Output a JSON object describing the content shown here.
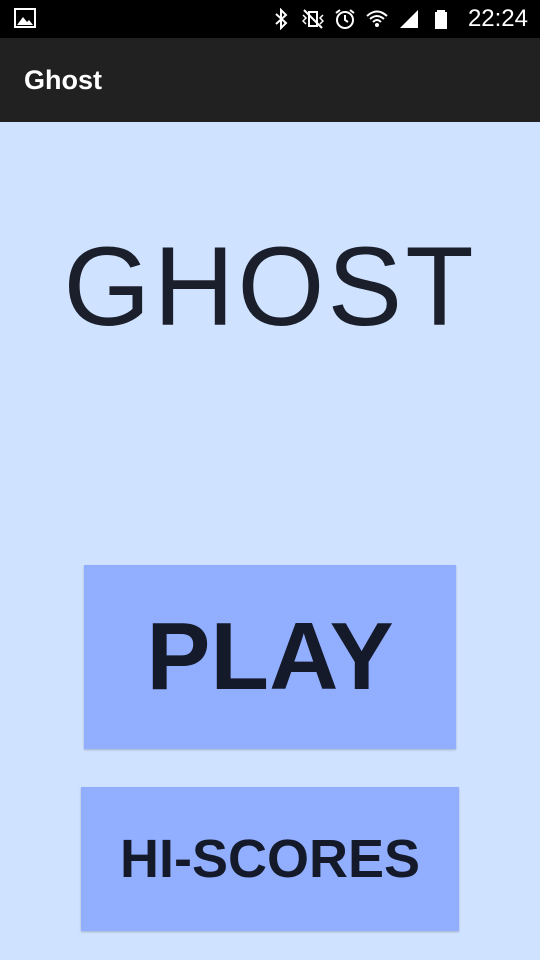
{
  "status_bar": {
    "time": "22:24",
    "icons": [
      "gallery-icon",
      "bluetooth-icon",
      "vibrate-icon",
      "alarm-icon",
      "wifi-icon",
      "cell-signal-icon",
      "battery-icon"
    ]
  },
  "app_bar": {
    "title": "Ghost"
  },
  "main": {
    "title": "GHOST",
    "play_label": "PLAY",
    "scores_label": "HI-SCORES"
  },
  "colors": {
    "background": "#cfe2ff",
    "button": "#92aeff",
    "app_bar": "#212121",
    "text_dark": "#1a1f2b"
  }
}
